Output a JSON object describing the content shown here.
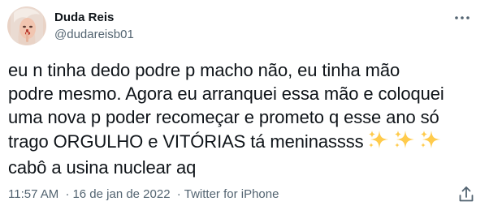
{
  "author": {
    "display_name": "Duda Reis",
    "handle": "@dudareisb01"
  },
  "tweet": {
    "lines": [
      "eu n tinha dedo podre p macho não, eu tinha mão",
      "podre mesmo. Agora eu arranquei essa mão e coloquei",
      "uma nova p poder recomeçar e prometo q esse ano só",
      "trago ORGULHO e VITÓRIAS tá meninassss",
      "cabô a usina nuclear aq"
    ],
    "emoji": [
      "sparkles-icon",
      "sparkles-icon",
      "sparkles-icon"
    ]
  },
  "meta": {
    "time": "11:57 AM",
    "separator": "·",
    "date": "16 de jan de 2022",
    "source": "Twitter for iPhone"
  },
  "icons": {
    "more": "more-options-icon",
    "share": "share-icon",
    "avatar": "avatar"
  },
  "colors": {
    "primary_text": "#0f1419",
    "secondary_text": "#536471",
    "sparkle": "#ffcb4c"
  }
}
